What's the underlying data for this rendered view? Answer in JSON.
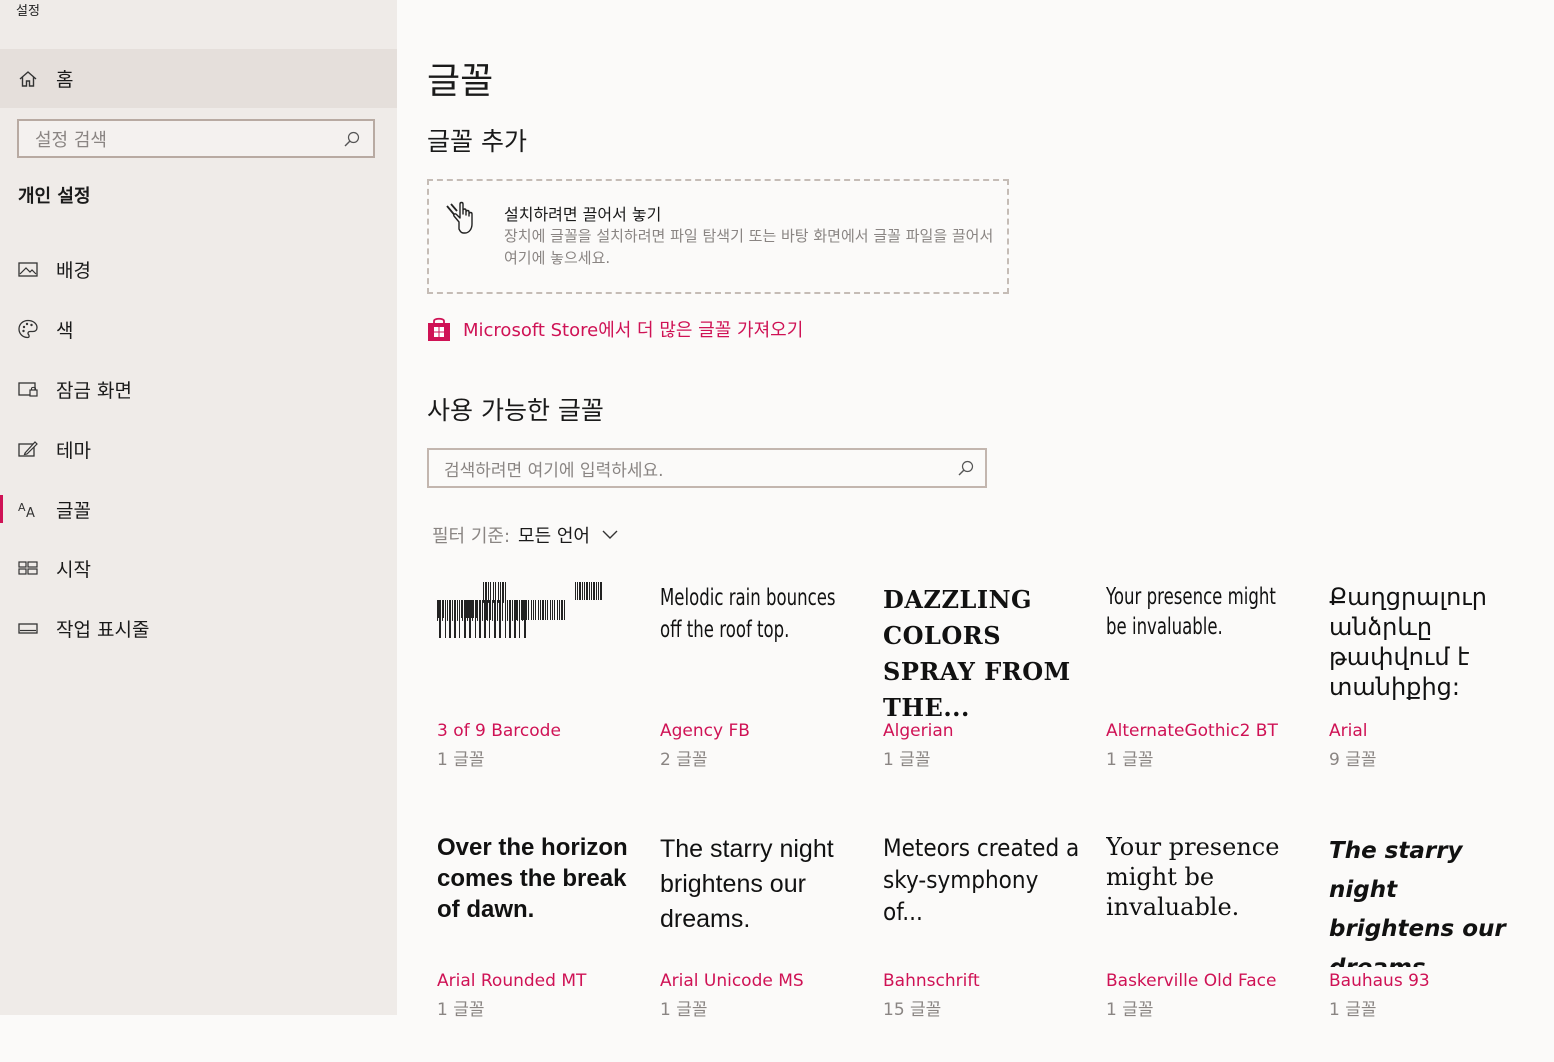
{
  "app": {
    "title": "설정"
  },
  "sidebar": {
    "home_label": "홈",
    "search_placeholder": "설정 검색",
    "section_title": "개인 설정",
    "items": [
      {
        "label": "배경",
        "icon": "picture-icon"
      },
      {
        "label": "색",
        "icon": "palette-icon"
      },
      {
        "label": "잠금 화면",
        "icon": "lock-screen-icon"
      },
      {
        "label": "테마",
        "icon": "theme-icon"
      },
      {
        "label": "글꼴",
        "icon": "font-icon",
        "active": true
      },
      {
        "label": "시작",
        "icon": "start-icon"
      },
      {
        "label": "작업 표시줄",
        "icon": "taskbar-icon"
      }
    ]
  },
  "main": {
    "title": "글꼴",
    "add_section_title": "글꼴 추가",
    "drop_zone": {
      "title": "설치하려면 끌어서 놓기",
      "description": "장치에 글꼴을 설치하려면 파일 탐색기 또는 바탕 화면에서 글꼴 파일을 끌어서 여기에 놓으세요."
    },
    "store_link": "Microsoft Store에서 더 많은 글꼴 가져오기",
    "available_title": "사용 가능한 글꼴",
    "font_search_placeholder": "검색하려면 여기에 입력하세요.",
    "filter": {
      "label": "필터 기준:",
      "value": "모든 언어"
    },
    "fonts": [
      {
        "name": "3 of 9 Barcode",
        "count": "1 글꼴",
        "sample": ""
      },
      {
        "name": "Agency FB",
        "count": "2 글꼴",
        "sample": "Melodic rain bounces off the roof top."
      },
      {
        "name": "Algerian",
        "count": "1 글꼴",
        "sample": "DAZZLING COLORS SPRAY FROM THE..."
      },
      {
        "name": "AlternateGothic2 BT",
        "count": "1 글꼴",
        "sample": "Your presence might be invaluable."
      },
      {
        "name": "Arial",
        "count": "9 글꼴",
        "sample": "Քաղցրալուր անձրևը թափվում է տանիքից:"
      },
      {
        "name": "Arial Rounded MT",
        "count": "1 글꼴",
        "sample": "Over the horizon comes the break of dawn."
      },
      {
        "name": "Arial Unicode MS",
        "count": "1 글꼴",
        "sample": "The starry night brightens our dreams."
      },
      {
        "name": "Bahnschrift",
        "count": "15 글꼴",
        "sample": "Meteors created a sky-symphony of..."
      },
      {
        "name": "Baskerville Old Face",
        "count": "1 글꼴",
        "sample": "Your presence might be invaluable."
      },
      {
        "name": "Bauhaus 93",
        "count": "1 글꼴",
        "sample": "The starry night brightens our dreams."
      }
    ]
  },
  "colors": {
    "accent": "#cf1255",
    "sidebar_bg": "#efebe8",
    "main_bg": "#fbfaf9"
  }
}
